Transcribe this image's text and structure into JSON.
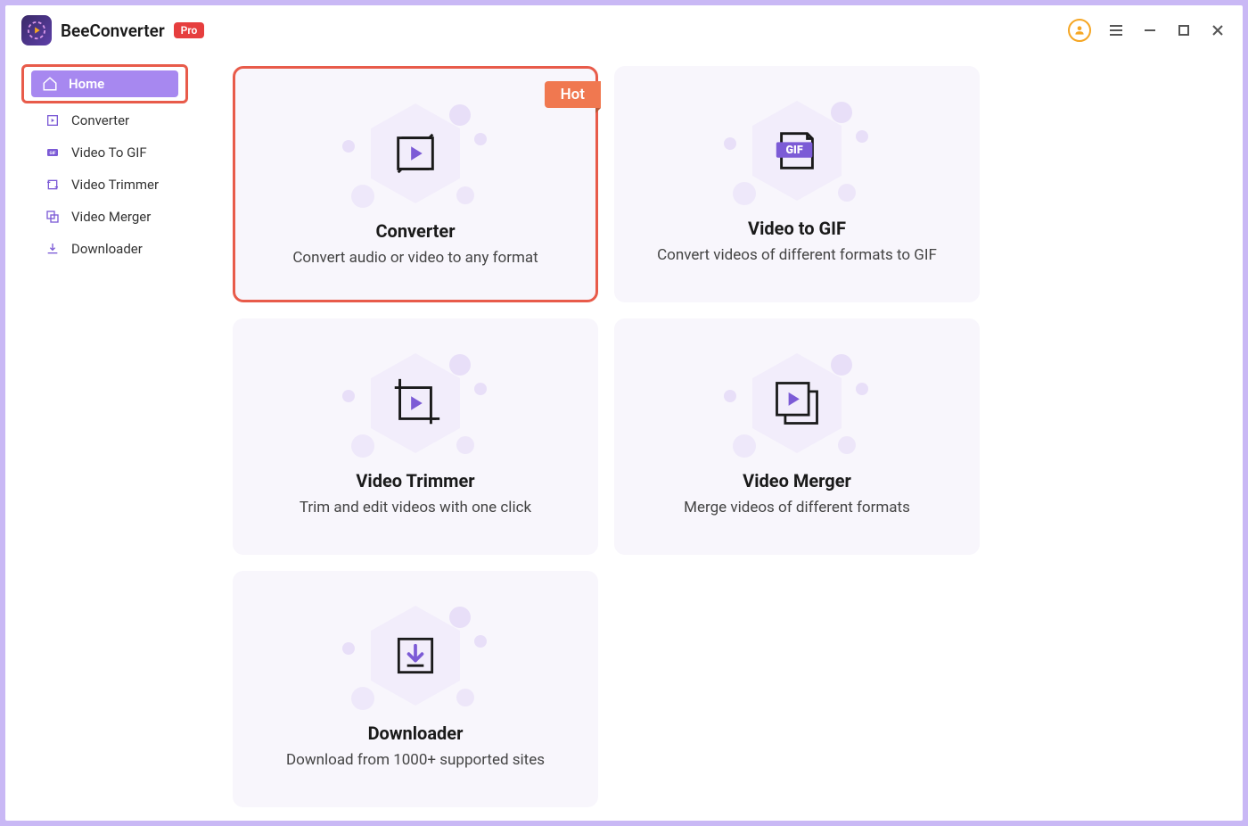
{
  "app": {
    "title": "BeeConverter",
    "badge": "Pro"
  },
  "sidebar": {
    "items": [
      {
        "label": "Home",
        "icon": "home",
        "active": true
      },
      {
        "label": "Converter",
        "icon": "converter",
        "active": false
      },
      {
        "label": "Video To GIF",
        "icon": "gif",
        "active": false
      },
      {
        "label": "Video Trimmer",
        "icon": "trimmer",
        "active": false
      },
      {
        "label": "Video Merger",
        "icon": "merger",
        "active": false
      },
      {
        "label": "Downloader",
        "icon": "downloader",
        "active": false
      }
    ]
  },
  "cards": [
    {
      "title": "Converter",
      "desc": "Convert audio or video to any format",
      "badge": "Hot",
      "highlighted": true,
      "icon": "converter"
    },
    {
      "title": "Video to GIF",
      "desc": "Convert videos of different formats to GIF",
      "icon": "gif"
    },
    {
      "title": "Video Trimmer",
      "desc": "Trim and edit videos with one click",
      "icon": "trimmer"
    },
    {
      "title": "Video Merger",
      "desc": "Merge videos of different formats",
      "icon": "merger"
    },
    {
      "title": "Downloader",
      "desc": "Download from 1000+ supported sites",
      "icon": "downloader"
    }
  ]
}
